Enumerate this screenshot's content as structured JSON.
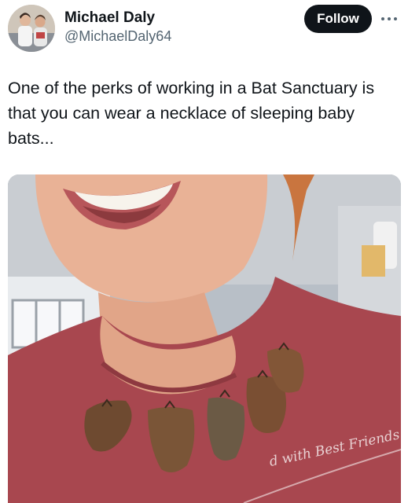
{
  "author": {
    "name": "Michael Daly",
    "handle": "@MichaelDaly64"
  },
  "actions": {
    "follow_label": "Follow",
    "more_icon": "more-horizontal-icon"
  },
  "post": {
    "text": "One of the perks of working in a Bat Sanctuary is that you can wear a necklace of sleeping baby bats...",
    "media_shirt_text": "d with Best Friends"
  },
  "colors": {
    "text_primary": "#0f1419",
    "text_secondary": "#536471",
    "follow_bg": "#0f1419",
    "shirt": "#a8474f"
  }
}
